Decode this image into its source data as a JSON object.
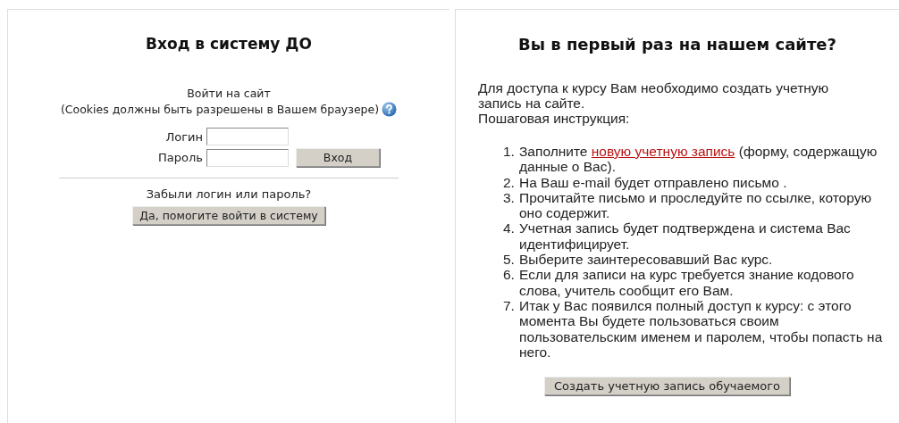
{
  "login_panel": {
    "title": "Вход в систему ДО",
    "prompt": "Войти на сайт",
    "cookies_note": "(Cookies должны быть разрешены в Вашем браузере)",
    "fields": [
      {
        "label": "Логин"
      },
      {
        "label": "Пароль"
      }
    ],
    "submit_button": "Вход",
    "forgot_text": "Забыли логин или пароль?",
    "help_button": "Да, помогите войти в систему"
  },
  "signup_panel": {
    "title": "Вы в первый раз на нашем сайте?",
    "intro": "Для доступа к курсу Вам необходимо создать учетную запись на сайте.",
    "steps_heading": "Пошаговая инструкция:",
    "steps": [
      {
        "number": "1.",
        "kind": "link",
        "before": "Заполните ",
        "link": "новую учетную запись",
        "after": " (форму, содержащую данные о Вас)."
      },
      {
        "number": "2.",
        "kind": "plain",
        "text": "На Ваш e-mail будет отправлено письмо ."
      },
      {
        "number": "3.",
        "kind": "plain",
        "text": "Прочитайте письмо и проследуйте по ссылке, которую оно содержит."
      },
      {
        "number": "4.",
        "kind": "plain",
        "text": "Учетная запись будет подтверждена и система Вас идентифицирует."
      },
      {
        "number": "5.",
        "kind": "plain",
        "text": "Выберите заинтересовавший Вас курс."
      },
      {
        "number": "6.",
        "kind": "plain",
        "text": "Если для записи на курс требуется знание кодового слова, учитель сообщит его Вам."
      },
      {
        "number": "7.",
        "kind": "plain",
        "text": "Итак у Вас появился полный доступ к курсу: с этого момента Вы будете пользоваться своим пользовательским именем и паролем, чтобы попасть на него."
      }
    ],
    "create_button": "Создать учетную запись обучаемого"
  }
}
